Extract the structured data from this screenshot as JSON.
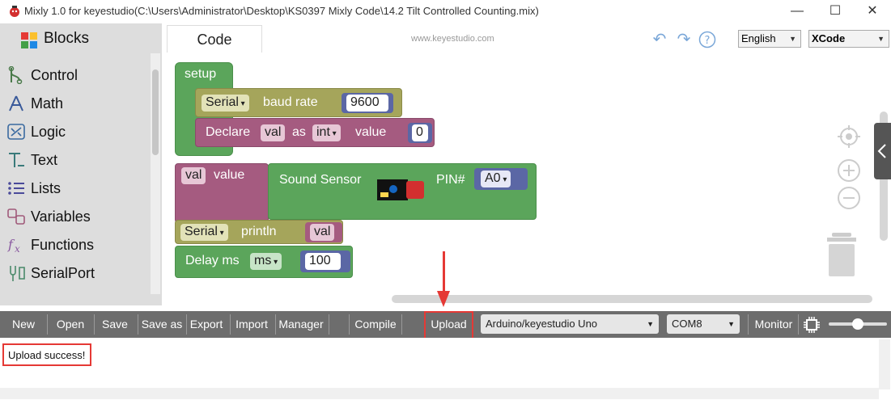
{
  "window": {
    "title": "Mixly 1.0 for keyestudio(C:\\Users\\Administrator\\Desktop\\KS0397 Mixly Code\\14.2 Tilt Controlled Counting.mix)",
    "minimize_icon": "minimize-icon",
    "maximize_icon": "maximize-icon",
    "close_icon": "close-icon"
  },
  "sidebar": {
    "tab_label": "Blocks",
    "items": [
      {
        "label": "Control",
        "icon": "control-icon"
      },
      {
        "label": "Math",
        "icon": "math-icon"
      },
      {
        "label": "Logic",
        "icon": "logic-icon"
      },
      {
        "label": "Text",
        "icon": "text-icon"
      },
      {
        "label": "Lists",
        "icon": "lists-icon"
      },
      {
        "label": "Variables",
        "icon": "variables-icon"
      },
      {
        "label": "Functions",
        "icon": "functions-icon"
      },
      {
        "label": "SerialPort",
        "icon": "serialport-icon"
      }
    ]
  },
  "header": {
    "code_tab": "Code",
    "watermark": "www.keyestudio.com",
    "language": "English",
    "code_mode": "XCode"
  },
  "blocks": {
    "setup": "setup",
    "serial_dd": "Serial",
    "baud_rate": "baud rate",
    "baud_value": "9600",
    "declare": "Declare",
    "var_name": "val",
    "as": "as",
    "type": "int",
    "value_kw": "value",
    "init_value": "0",
    "assign_var": "val",
    "assign_value_kw": "value",
    "sound_sensor": "Sound Sensor",
    "pin_label": "PIN#",
    "pin_value": "A0",
    "print_serial": "Serial",
    "println": "println",
    "print_var": "val",
    "delay": "Delay ms",
    "delay_unit": "ms",
    "delay_value": "100"
  },
  "toolbar": {
    "new": "New",
    "open": "Open",
    "save": "Save",
    "save_as": "Save as",
    "export": "Export",
    "import": "Import",
    "manager": "Manager",
    "compile": "Compile",
    "upload": "Upload",
    "board": "Arduino/keyestudio Uno",
    "port": "COM8",
    "monitor": "Monitor"
  },
  "output": {
    "message": "Upload success!"
  },
  "colors": {
    "loop_green": "#5ba55b",
    "serial_olive": "#a5a55b",
    "variable_pink": "#a55b80",
    "math_blue": "#5b67a5",
    "toolbar_gray": "#6d6d6d",
    "highlight_red": "#e53935"
  }
}
